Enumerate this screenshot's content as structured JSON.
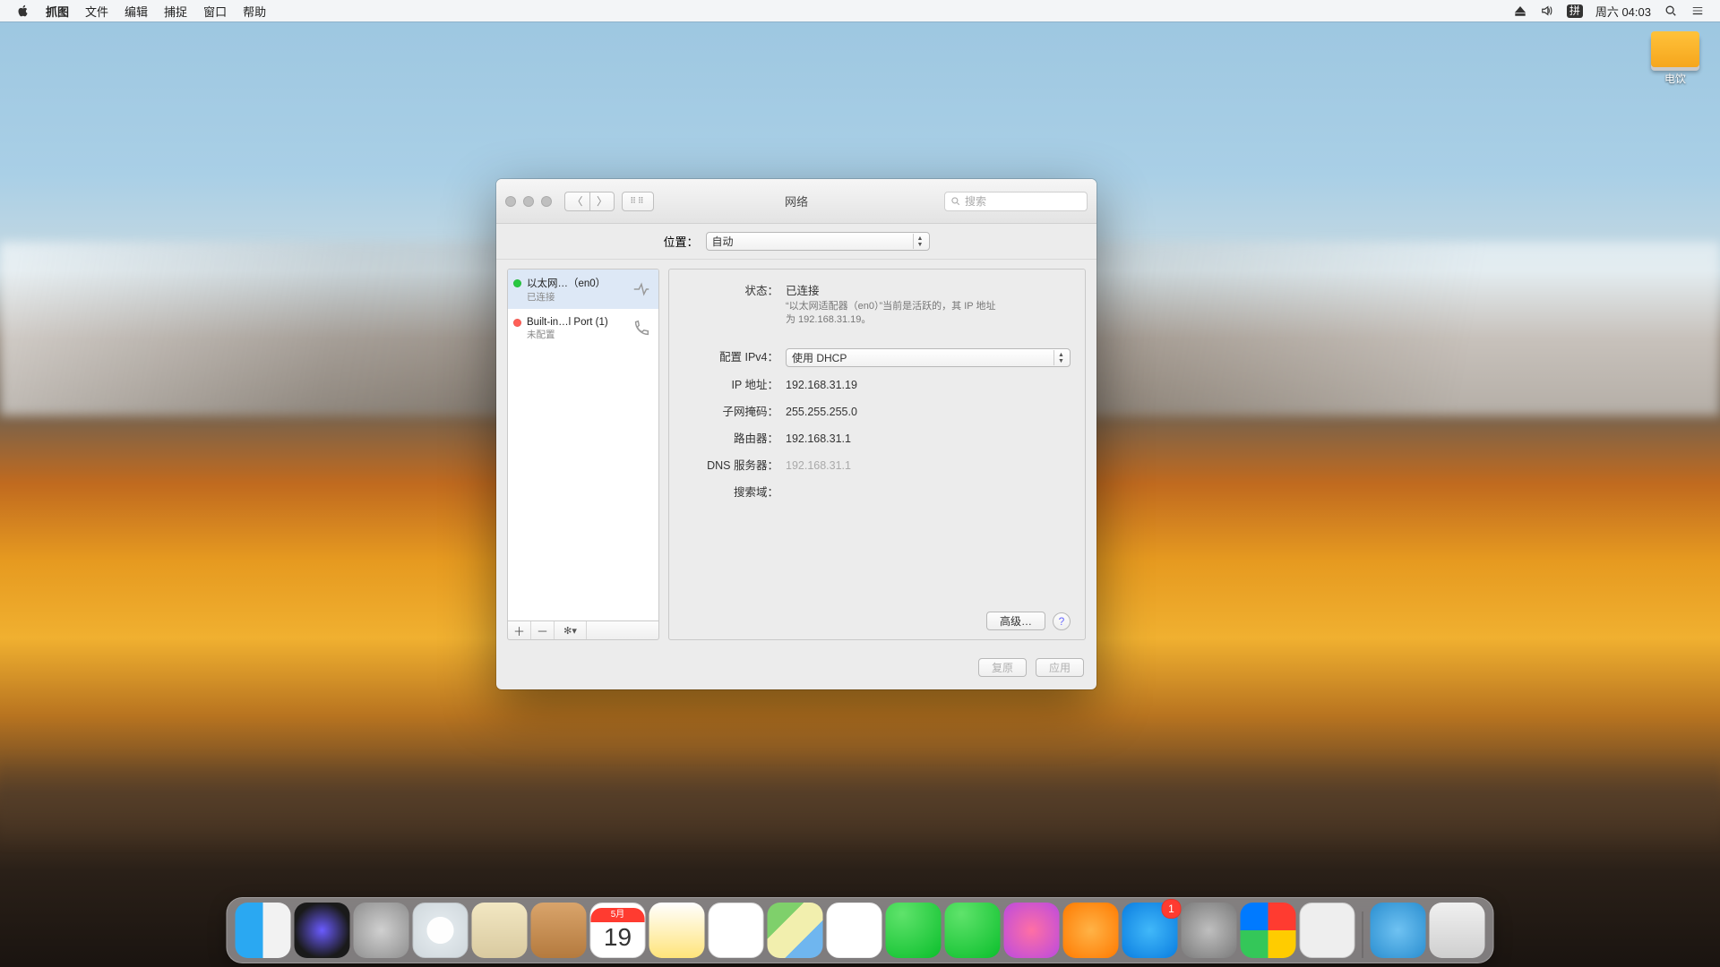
{
  "menubar": {
    "app": "抓图",
    "items": [
      "文件",
      "编辑",
      "捕捉",
      "窗口",
      "帮助"
    ],
    "ime": "拼",
    "clock": "周六 04:03"
  },
  "desktop": {
    "disk_label": "电饮"
  },
  "window": {
    "title": "网络",
    "search_placeholder": "搜索",
    "location_label": "位置：",
    "location_value": "自动",
    "sidebar": {
      "items": [
        {
          "name": "以太网…（en0）",
          "status": "已连接",
          "color": "green",
          "icon": "ethernet"
        },
        {
          "name": "Built-in…l Port (1)",
          "status": "未配置",
          "color": "red",
          "icon": "phone"
        }
      ]
    },
    "detail": {
      "status_label": "状态：",
      "status_value": "已连接",
      "status_desc": "“以太网适配器（en0）”当前是活跃的，其 IP 地址为 192.168.31.19。",
      "ipv4_label": "配置 IPv4：",
      "ipv4_value": "使用 DHCP",
      "ip_label": "IP 地址：",
      "ip_value": "192.168.31.19",
      "mask_label": "子网掩码：",
      "mask_value": "255.255.255.0",
      "router_label": "路由器：",
      "router_value": "192.168.31.1",
      "dns_label": "DNS 服务器：",
      "dns_value": "192.168.31.1",
      "search_label": "搜索域：",
      "search_value": "",
      "advanced": "高级…",
      "help": "?",
      "revert": "复原",
      "apply": "应用"
    }
  },
  "dock": {
    "calendar_month": "5月",
    "calendar_day": "19",
    "appstore_badge": "1",
    "items": [
      "finder",
      "siri",
      "launchpad",
      "safari",
      "mail",
      "contacts",
      "calendar",
      "notes",
      "reminders",
      "maps",
      "photos",
      "messages",
      "facetime",
      "itunes",
      "ibooks",
      "appstore",
      "syspref",
      "dashboard",
      "utilities",
      "downloads",
      "trash"
    ]
  }
}
